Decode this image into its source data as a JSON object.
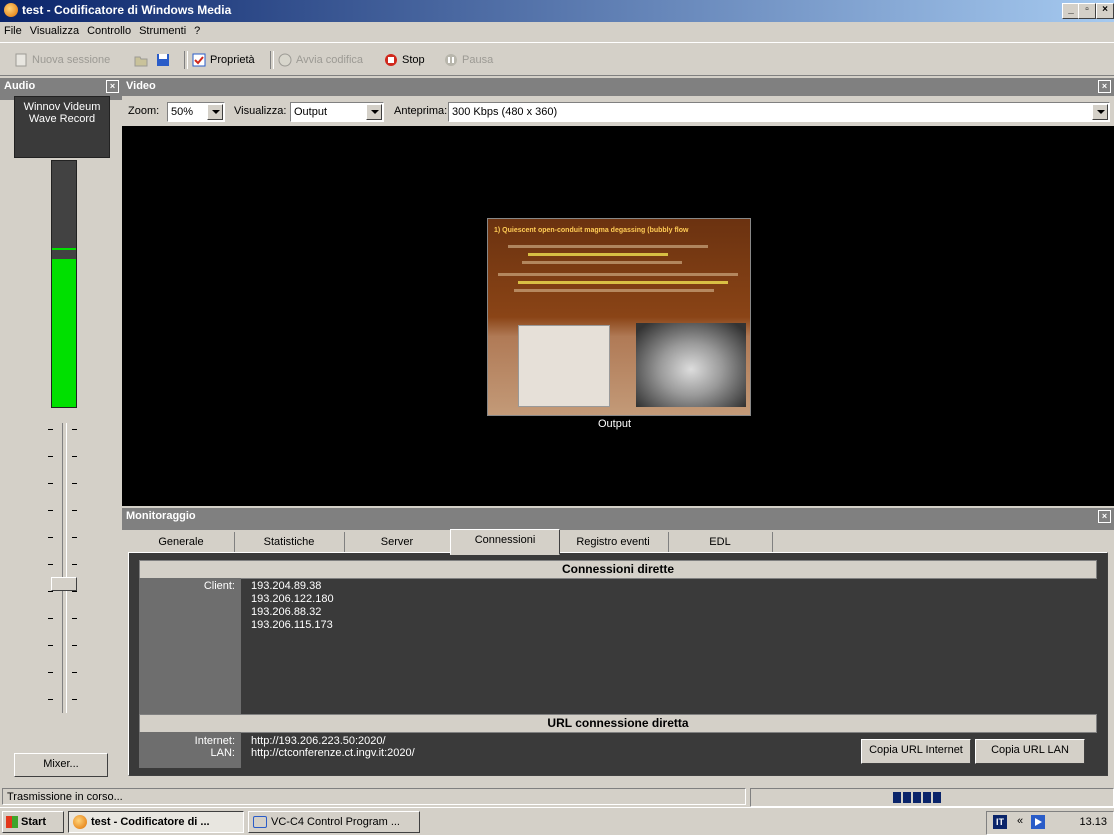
{
  "window": {
    "title": "test - Codificatore di Windows Media"
  },
  "menu": [
    "File",
    "Visualizza",
    "Controllo",
    "Strumenti",
    "?"
  ],
  "toolbar": {
    "new_session": "Nuova sessione",
    "properties": "Proprietà",
    "start_encoding": "Avvia codifica",
    "stop": "Stop",
    "pause": "Pausa"
  },
  "audio": {
    "header": "Audio",
    "device": "Winnov Videum Wave Record",
    "level_fraction": 0.6,
    "peak_fraction": 0.64,
    "volume_fraction": 0.55,
    "mixer_label": "Mixer..."
  },
  "video": {
    "header": "Video",
    "zoom_label": "Zoom:",
    "zoom_value": "50%",
    "view_label": "Visualizza:",
    "view_value": "Output",
    "preview_label": "Anteprima:",
    "preview_value": "300 Kbps (480 x 360)",
    "output_caption": "Output",
    "slide_title": "1) Quiescent open-conduit magma degassing (bubbly flow"
  },
  "monitor": {
    "header": "Monitoraggio",
    "tabs": [
      "Generale",
      "Statistiche",
      "Server",
      "Connessioni",
      "Registro eventi",
      "EDL"
    ],
    "active_tab": "Connessioni",
    "direct_connections_title": "Connessioni dirette",
    "client_label": "Client:",
    "clients": [
      "193.204.89.38",
      "193.206.122.180",
      "193.206.88.32",
      "193.206.115.173"
    ],
    "url_title": "URL connessione diretta",
    "internet_label": "Internet:",
    "internet_url": "http://193.206.223.50:2020/",
    "lan_label": "LAN:",
    "lan_url": "http://ctconferenze.ct.ingv.it:2020/",
    "copy_internet_btn": "Copia URL Internet",
    "copy_lan_btn": "Copia URL LAN"
  },
  "status": {
    "text": "Trasmissione in corso..."
  },
  "taskbar": {
    "start": "Start",
    "items": [
      "test - Codificatore di ...",
      "VC-C4 Control Program ..."
    ],
    "lang": "IT",
    "clock": "13.13"
  }
}
